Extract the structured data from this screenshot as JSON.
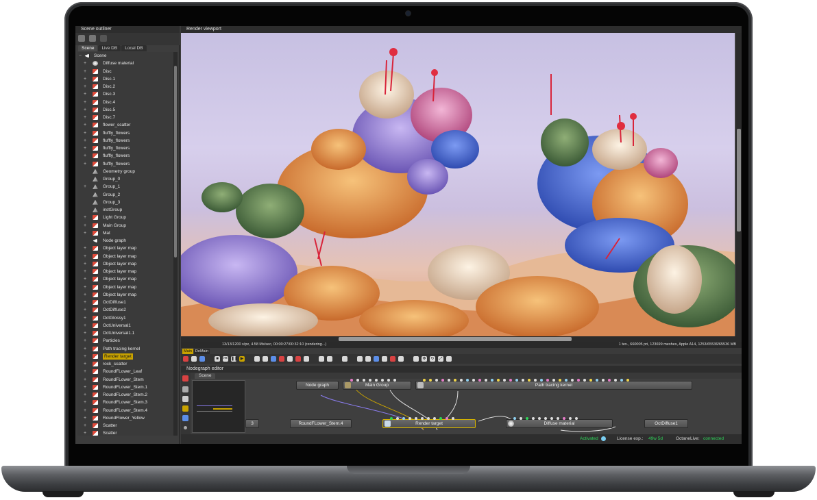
{
  "outliner": {
    "title": "Scene outliner",
    "tabs": [
      "Scene",
      "Live DB",
      "Local DB"
    ],
    "root": "Scene",
    "items": [
      {
        "label": "Diffuse material",
        "icon": "material-icon",
        "expand": "+"
      },
      {
        "label": "Disc",
        "icon": "geometry-icon",
        "expand": "+"
      },
      {
        "label": "Disc.1",
        "icon": "geometry-icon",
        "expand": "+"
      },
      {
        "label": "Disc.2",
        "icon": "geometry-icon",
        "expand": "+"
      },
      {
        "label": "Disc.3",
        "icon": "geometry-icon",
        "expand": "+"
      },
      {
        "label": "Disc.4",
        "icon": "geometry-icon",
        "expand": "+"
      },
      {
        "label": "Disc.5",
        "icon": "geometry-icon",
        "expand": "+"
      },
      {
        "label": "Disc.7",
        "icon": "geometry-icon",
        "expand": "+"
      },
      {
        "label": "flower_scatter",
        "icon": "geometry-icon",
        "expand": "+"
      },
      {
        "label": "fluffly_flowers",
        "icon": "geometry-icon",
        "expand": "+"
      },
      {
        "label": "fluffly_flowers",
        "icon": "geometry-icon",
        "expand": "+"
      },
      {
        "label": "fluffly_flowers",
        "icon": "geometry-icon",
        "expand": "+"
      },
      {
        "label": "fluffly_flowers",
        "icon": "geometry-icon",
        "expand": "+"
      },
      {
        "label": "fluffly_flowers",
        "icon": "geometry-icon",
        "expand": "+"
      },
      {
        "label": "Geometry group",
        "icon": "group-icon",
        "expand": ""
      },
      {
        "label": "Group_0",
        "icon": "group-icon",
        "expand": ""
      },
      {
        "label": "Group_1",
        "icon": "group-icon",
        "expand": "+"
      },
      {
        "label": "Group_2",
        "icon": "group-icon",
        "expand": ""
      },
      {
        "label": "Group_3",
        "icon": "group-icon",
        "expand": ""
      },
      {
        "label": "instGroup",
        "icon": "group-icon",
        "expand": ""
      },
      {
        "label": "Light Group",
        "icon": "geometry-icon",
        "expand": "+"
      },
      {
        "label": "Main Group",
        "icon": "geometry-icon",
        "expand": "+"
      },
      {
        "label": "Mat",
        "icon": "geometry-icon",
        "expand": "+"
      },
      {
        "label": "Node graph",
        "icon": "node-icon",
        "expand": ""
      },
      {
        "label": "Object layer map",
        "icon": "geometry-icon",
        "expand": "+"
      },
      {
        "label": "Object layer map",
        "icon": "geometry-icon",
        "expand": "+"
      },
      {
        "label": "Object layer map",
        "icon": "geometry-icon",
        "expand": "+"
      },
      {
        "label": "Object layer map",
        "icon": "geometry-icon",
        "expand": "+"
      },
      {
        "label": "Object layer map",
        "icon": "geometry-icon",
        "expand": "+"
      },
      {
        "label": "Object layer map",
        "icon": "geometry-icon",
        "expand": "+"
      },
      {
        "label": "Object layer map",
        "icon": "geometry-icon",
        "expand": "+"
      },
      {
        "label": "OctDiffuse1",
        "icon": "geometry-icon",
        "expand": "+"
      },
      {
        "label": "OctDiffuse2",
        "icon": "geometry-icon",
        "expand": "+"
      },
      {
        "label": "OctGlossy1",
        "icon": "geometry-icon",
        "expand": "+"
      },
      {
        "label": "OctUniversal1",
        "icon": "geometry-icon",
        "expand": "+"
      },
      {
        "label": "OctUniversal1.1",
        "icon": "geometry-icon",
        "expand": "+"
      },
      {
        "label": "Particles",
        "icon": "geometry-icon",
        "expand": "+"
      },
      {
        "label": "Path tracing kernel",
        "icon": "geometry-icon",
        "expand": "+"
      },
      {
        "label": "Render target",
        "icon": "geometry-icon",
        "expand": "+",
        "selected": true
      },
      {
        "label": "rock_scatter",
        "icon": "geometry-icon",
        "expand": "+"
      },
      {
        "label": "RoundFLower_Leaf",
        "icon": "geometry-icon",
        "expand": "+"
      },
      {
        "label": "RoundFLower_Stem",
        "icon": "geometry-icon",
        "expand": "+"
      },
      {
        "label": "RoundFLower_Stem.1",
        "icon": "geometry-icon",
        "expand": "+"
      },
      {
        "label": "RoundFLower_Stem.2",
        "icon": "geometry-icon",
        "expand": "+"
      },
      {
        "label": "RoundFLower_Stem.3",
        "icon": "geometry-icon",
        "expand": "+"
      },
      {
        "label": "RoundFLower_Stem.4",
        "icon": "geometry-icon",
        "expand": "+"
      },
      {
        "label": "RoundFlower_Yellow",
        "icon": "geometry-icon",
        "expand": "+"
      },
      {
        "label": "Scatter",
        "icon": "geometry-icon",
        "expand": "+"
      },
      {
        "label": "Scatter",
        "icon": "geometry-icon",
        "expand": "+"
      }
    ]
  },
  "viewport": {
    "title": "Render viewport",
    "status_left": "13/13/1200 s/px, 4.58 Ms/sec, 00:00:27/00:32:10 (rendering...)",
    "status_right": "1 tex., 660005 pri, 123699 meshes, Apple A14, 1253/65536/65536 MB",
    "mode_tabs": [
      "Main",
      "DeMain"
    ]
  },
  "nodegraph": {
    "title": "Nodegraph editor",
    "tab": "Scene",
    "nodes": {
      "node_graph": "Node graph",
      "main_group": "Main Group",
      "path_tracing_kernel": "Path tracing kernel",
      "partial_left": "3",
      "round_flower_stem_4": "RoundFLower_Stem.4",
      "render_target": "Render target",
      "diffuse_material": "Diffuse material",
      "oct_diffuse_1": "OctDiffuse1"
    }
  },
  "status": {
    "activated": "Activated",
    "license_label": "License exp.:",
    "license_value": "49w 5d",
    "octanelive_label": "OctaneLive:",
    "octanelive_value": "connected"
  },
  "colors": {
    "accent": "#c9a300",
    "connected": "#2fd35a",
    "panel": "#3b3b3b"
  }
}
